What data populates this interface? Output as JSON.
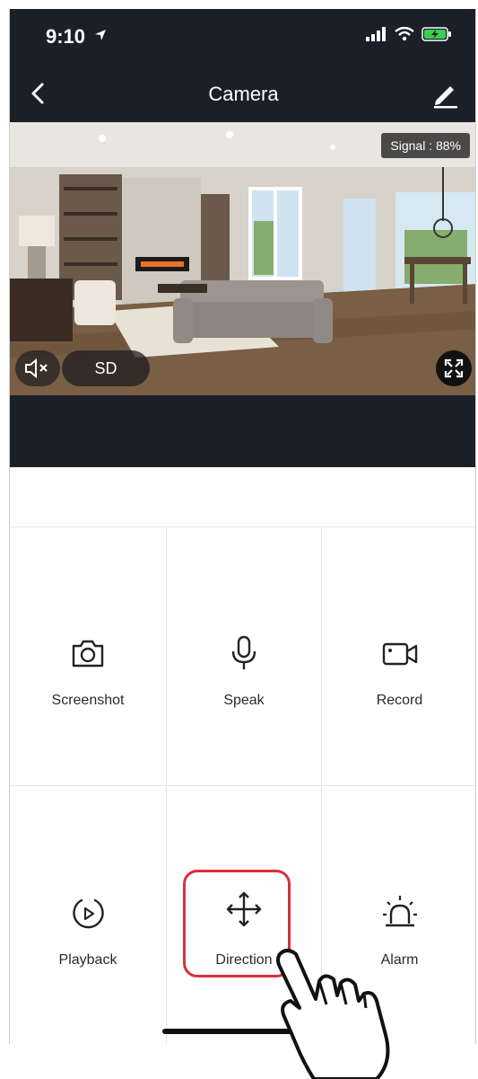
{
  "status_bar": {
    "time": "9:10",
    "location_icon": "location-arrow-icon",
    "signal_icon": "cellular-signal-icon",
    "wifi_icon": "wifi-icon",
    "battery_icon": "battery-charging-icon",
    "battery_color": "#3ad04f"
  },
  "nav": {
    "title": "Camera",
    "back_icon": "chevron-left-icon",
    "edit_icon": "pencil-icon"
  },
  "video": {
    "signal_label": "Signal : 88%",
    "quality": "SD",
    "mute_icon": "speaker-muted-icon",
    "fullscreen_icon": "fullscreen-icon"
  },
  "actions": [
    {
      "label": "Screenshot",
      "icon": "camera-icon"
    },
    {
      "label": "Speak",
      "icon": "microphone-icon"
    },
    {
      "label": "Record",
      "icon": "video-camera-icon"
    },
    {
      "label": "Playback",
      "icon": "playback-icon"
    },
    {
      "label": "Direction",
      "icon": "move-arrows-icon"
    },
    {
      "label": "Alarm",
      "icon": "alarm-siren-icon"
    }
  ],
  "colors": {
    "dark_bar": "#1b2028",
    "highlight": "#d9303a"
  }
}
